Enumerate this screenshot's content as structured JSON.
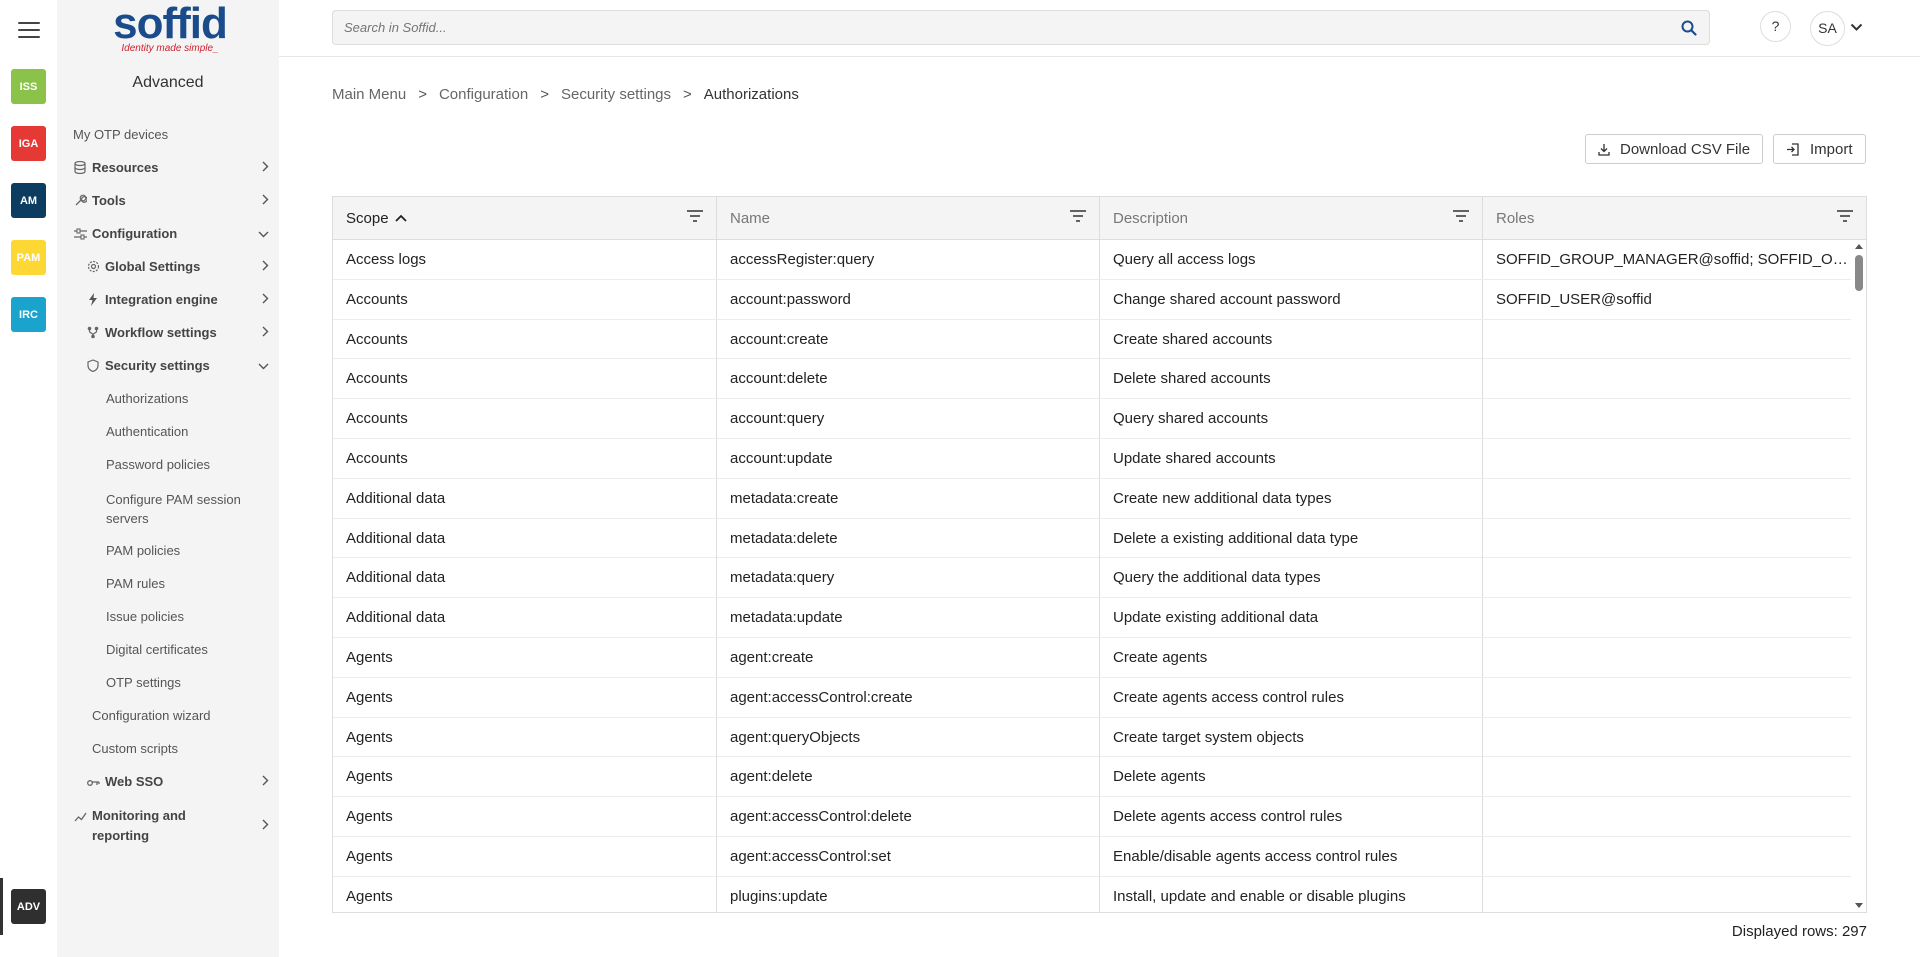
{
  "apps": [
    {
      "label": "ISS",
      "color": "#8bc34a"
    },
    {
      "label": "IGA",
      "color": "#e53935"
    },
    {
      "label": "AM",
      "color": "#0d3c61"
    },
    {
      "label": "PAM",
      "color": "#fdd835"
    },
    {
      "label": "IRC",
      "color": "#1aa3cc"
    }
  ],
  "active_app": {
    "label": "ADV",
    "color": "#2f2f2f"
  },
  "logo": {
    "word": "soffid",
    "tagline": "Identity made simple_"
  },
  "sidebar": {
    "title": "Advanced",
    "items": [
      {
        "label": "My OTP devices"
      },
      {
        "label": "Resources"
      },
      {
        "label": "Tools"
      },
      {
        "label": "Configuration"
      },
      {
        "label": "Global Settings"
      },
      {
        "label": "Integration engine"
      },
      {
        "label": "Workflow settings"
      },
      {
        "label": "Security settings"
      },
      {
        "label": "Authorizations"
      },
      {
        "label": "Authentication"
      },
      {
        "label": "Password policies"
      },
      {
        "label": "Configure PAM session servers"
      },
      {
        "label": "PAM policies"
      },
      {
        "label": "PAM rules"
      },
      {
        "label": "Issue policies"
      },
      {
        "label": "Digital certificates"
      },
      {
        "label": "OTP settings"
      },
      {
        "label": "Configuration wizard"
      },
      {
        "label": "Custom scripts"
      },
      {
        "label": "Web SSO"
      },
      {
        "label": "Monitoring and reporting"
      }
    ]
  },
  "search": {
    "placeholder": "Search in Soffid..."
  },
  "header": {
    "help": "?",
    "avatar": "SA"
  },
  "breadcrumb": [
    "Main Menu",
    ">",
    "Configuration",
    ">",
    "Security settings",
    ">",
    "Authorizations"
  ],
  "actions": {
    "download": "Download CSV File",
    "import": "Import"
  },
  "table": {
    "columns": [
      "Scope",
      "Name",
      "Description",
      "Roles"
    ],
    "rows": [
      [
        "Access logs",
        "accessRegister:query",
        "Query all access logs",
        "SOFFID_GROUP_MANAGER@soffid; SOFFID_OPERATOR@soffid"
      ],
      [
        "Accounts",
        "account:password",
        "Change shared account password",
        "SOFFID_USER@soffid"
      ],
      [
        "Accounts",
        "account:create",
        "Create shared accounts",
        ""
      ],
      [
        "Accounts",
        "account:delete",
        "Delete shared accounts",
        ""
      ],
      [
        "Accounts",
        "account:query",
        "Query shared accounts",
        ""
      ],
      [
        "Accounts",
        "account:update",
        "Update shared accounts",
        ""
      ],
      [
        "Additional data",
        "metadata:create",
        "Create new additional data types",
        ""
      ],
      [
        "Additional data",
        "metadata:delete",
        "Delete a existing additional data type",
        ""
      ],
      [
        "Additional data",
        "metadata:query",
        "Query the additional data types",
        ""
      ],
      [
        "Additional data",
        "metadata:update",
        "Update existing additional data",
        ""
      ],
      [
        "Agents",
        "agent:create",
        "Create agents",
        ""
      ],
      [
        "Agents",
        "agent:accessControl:create",
        "Create agents access control rules",
        ""
      ],
      [
        "Agents",
        "agent:queryObjects",
        "Create target system objects",
        ""
      ],
      [
        "Agents",
        "agent:delete",
        "Delete agents",
        ""
      ],
      [
        "Agents",
        "agent:accessControl:delete",
        "Delete agents access control rules",
        ""
      ],
      [
        "Agents",
        "agent:accessControl:set",
        "Enable/disable agents access control rules",
        ""
      ],
      [
        "Agents",
        "plugins:update",
        "Install, update and enable or disable plugins",
        ""
      ]
    ]
  },
  "footer": {
    "rows_label": "Displayed rows: 297"
  }
}
